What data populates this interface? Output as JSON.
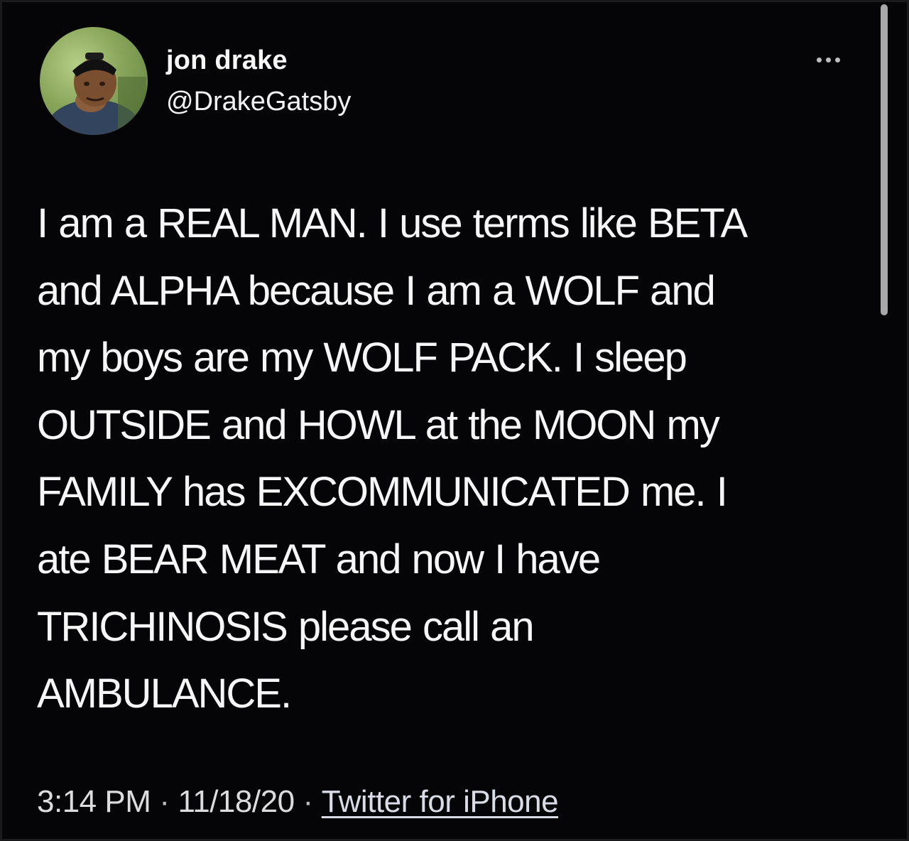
{
  "tweet": {
    "author_name": "jon drake",
    "author_handle": "@DrakeGatsby",
    "text_lines": [
      "I am a REAL MAN. I use terms like BETA",
      "and ALPHA because I am a WOLF and",
      "my boys are my WOLF PACK. I sleep",
      "OUTSIDE and HOWL at the MOON my",
      "FAMILY has EXCOMMUNICATED me. I",
      "ate BEAR MEAT and now I have",
      "TRICHINOSIS please call an",
      "AMBULANCE."
    ],
    "time": "3:14 PM",
    "date": "11/18/20",
    "separator": "·",
    "source": "Twitter for iPhone"
  },
  "icons": {
    "more": "more-options-icon",
    "avatar": "profile-photo"
  },
  "colors": {
    "background": "#050507",
    "text": "#f6f6f6",
    "meta": "#dcdcdc"
  }
}
